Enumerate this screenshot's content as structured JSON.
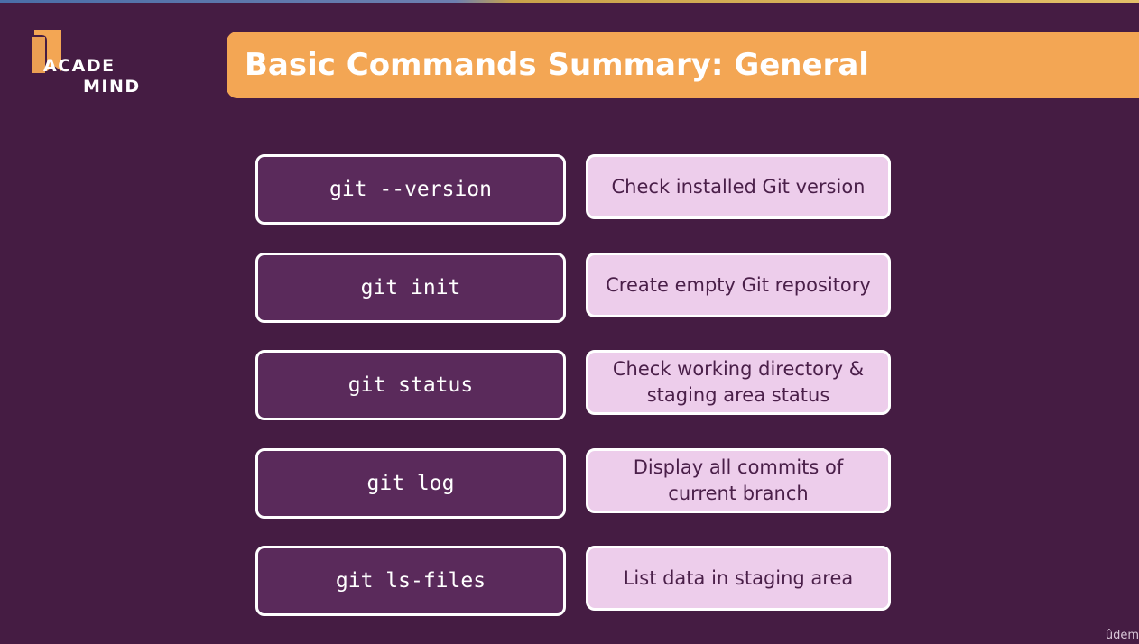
{
  "brand": {
    "logo_line1": "ACADE",
    "logo_line2": "MIND",
    "flag_color": "#f3a654"
  },
  "slide": {
    "title": "Basic Commands Summary: General"
  },
  "commands": [
    {
      "command": "git --version",
      "description": "Check installed Git version"
    },
    {
      "command": "git init",
      "description": "Create empty Git repository"
    },
    {
      "command": "git status",
      "description": "Check working directory &\nstaging area status"
    },
    {
      "command": "git log",
      "description": "Display all commits of\ncurrent branch"
    },
    {
      "command": "git ls-files",
      "description": "List data in staging area"
    }
  ],
  "watermark": "ûdem",
  "colors": {
    "background": "#451c43",
    "title_bar": "#f3a654",
    "command_box": "#5a2a5b",
    "description_box": "#edcdeb"
  }
}
